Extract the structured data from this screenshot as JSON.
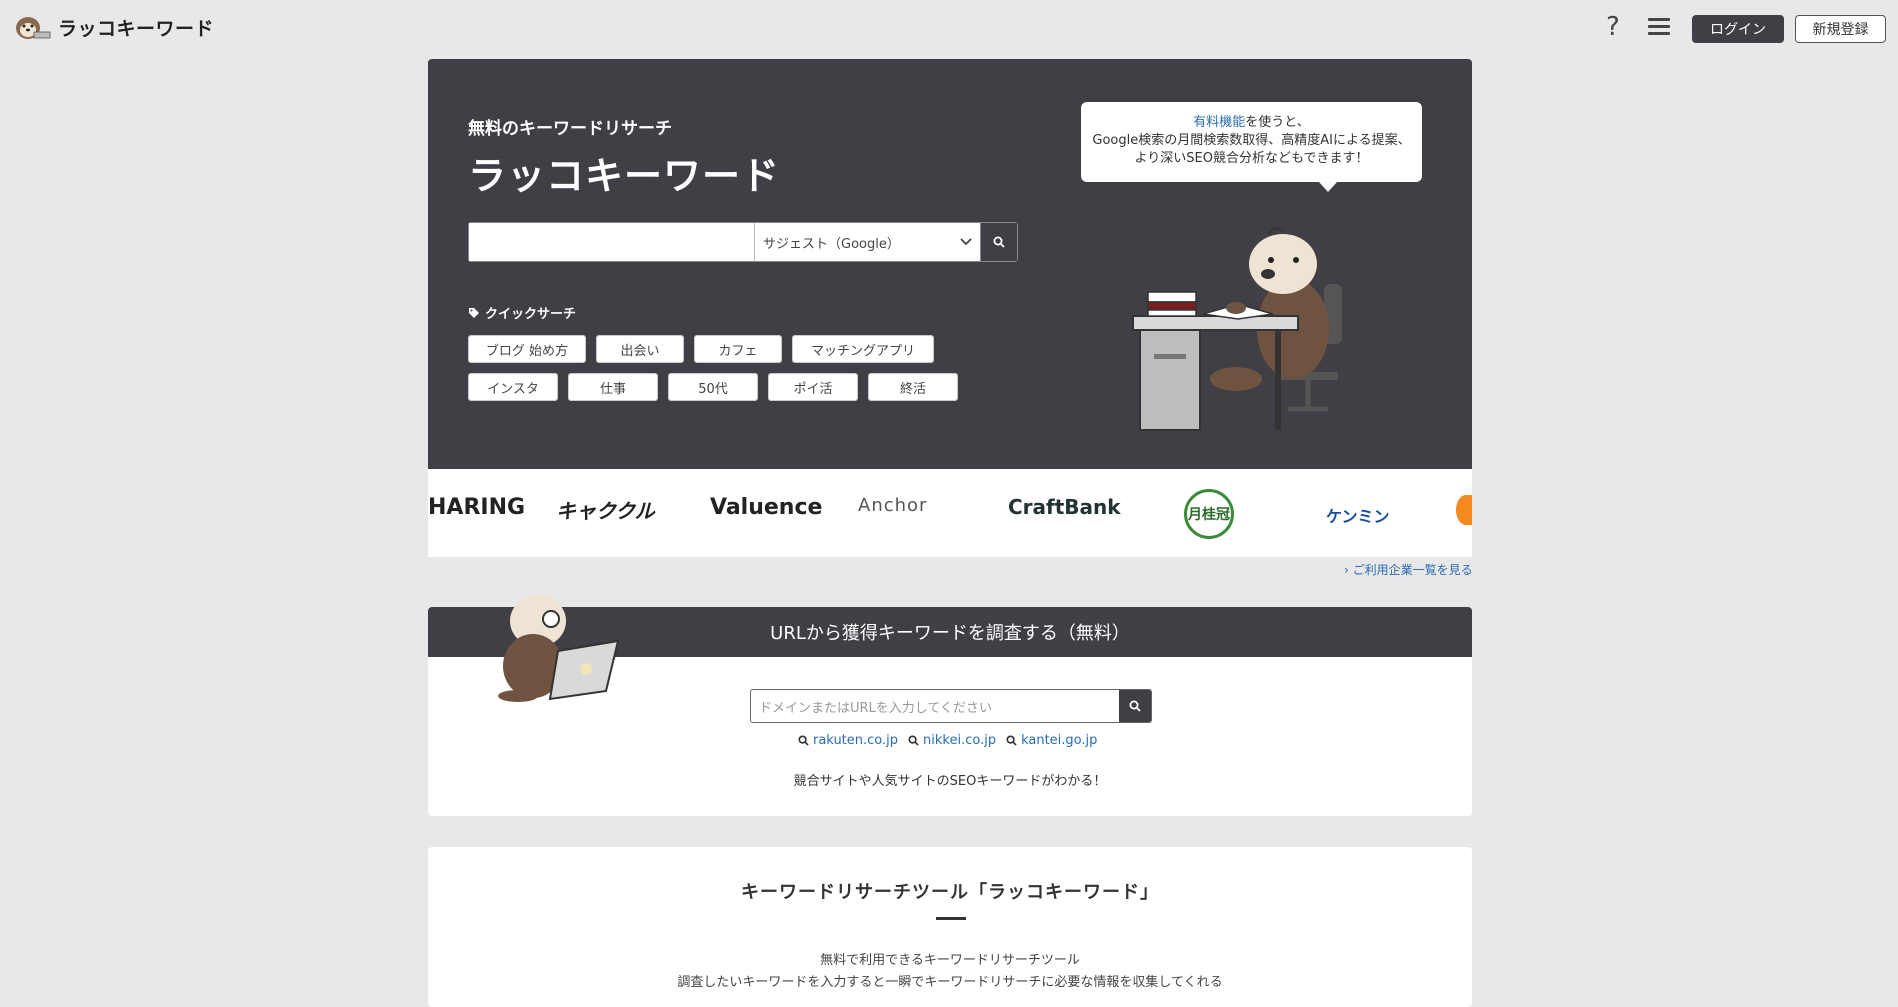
{
  "header": {
    "logo_text": "ラッコキーワード",
    "help_icon": "question-icon",
    "menu_icon": "hamburger-icon",
    "login_label": "ログイン",
    "register_label": "新規登録"
  },
  "hero": {
    "subtitle": "無料のキーワードリサーチ",
    "title": "ラッコキーワード",
    "search_value": "",
    "source_select": "サジェスト（Google）",
    "quick_label": "クイックサーチ",
    "chips_row1": [
      "ブログ 始め方",
      "出会い",
      "カフェ",
      "マッチングアプリ"
    ],
    "chips_row2": [
      "インスタ",
      "仕事",
      "50代",
      "ポイ活",
      "終活"
    ],
    "bubble": {
      "link": "有料機能",
      "line1_rest": "を使うと、",
      "line2": "Google検索の月間検索数取得、高精度AIによる提案、",
      "line3": "より深いSEO競合分析などもできます！"
    }
  },
  "logos": [
    "HARING",
    "キャククル",
    "Valuence",
    "Anchor",
    "CraftBank",
    "月桂冠",
    "ケンミン"
  ],
  "logos_more": "ご利用企業一覧を見る",
  "url_section": {
    "title": "URLから獲得キーワードを調査する（無料）",
    "placeholder": "ドメインまたはURLを入力してください",
    "examples": [
      "rakuten.co.jp",
      "nikkei.co.jp",
      "kantei.go.jp"
    ],
    "note": "競合サイトや人気サイトのSEOキーワードがわかる！"
  },
  "about": {
    "title": "キーワードリサーチツール「ラッコキーワード」",
    "line1": "無料で利用できるキーワードリサーチツール",
    "line2": "調査したいキーワードを入力すると一瞬でキーワードリサーチに必要な情報を収集してくれる"
  },
  "colors": {
    "dark": "#3f3f45",
    "link": "#2b6cb0",
    "background": "#e8e8e8"
  }
}
